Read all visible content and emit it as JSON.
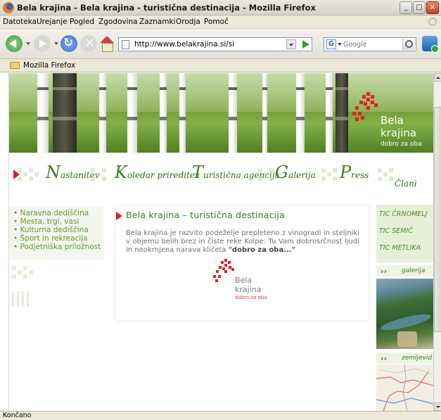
{
  "window": {
    "title": "Bela krajina - Bela krajina - turistična destinacija - Mozilla Firefox"
  },
  "menubar": {
    "items": [
      "Datoteka",
      "Urejanje",
      "Pogled",
      "Zgodovina",
      "Zaznamki",
      "Orodja",
      "Pomoč"
    ]
  },
  "navbar": {
    "url": "http://www.belakrajina.si/si",
    "search_placeholder": "Google"
  },
  "bookmarks": {
    "items": [
      "Mozilla Firefox"
    ]
  },
  "site": {
    "banner": {
      "brand_line1": "Bela",
      "brand_line2": "krajina",
      "slogan": "dobro za oba"
    },
    "nav": {
      "items": [
        {
          "cap": "N",
          "rest": "astanitev"
        },
        {
          "cap": "K",
          "rest": "oledar prireditev"
        },
        {
          "cap": "T",
          "rest": "uristična agencija"
        },
        {
          "cap": "G",
          "rest": "alerija"
        },
        {
          "cap": "P",
          "rest": "ress"
        },
        {
          "cap": "",
          "rest": "Člani"
        }
      ]
    },
    "left_menu": [
      "Naravna dediščina",
      "Mesta, trgi, vasi",
      "Kulturna dediščina",
      "Šport in rekreacija",
      "Podjetniška priložnost"
    ],
    "main": {
      "heading": "Bela krajina – turistična destinacija",
      "body": "Bela krajina je razvito podeželje prepleteno z vinogradi in steljniki v objemu belih brez in čiste reke Kolpe. Tu Vam dobrosrčnost ljudi in neokrnjena narava kličeta ",
      "body_bold": "\"dobro za oba...\"",
      "logo_line1": "Bela",
      "logo_line2": "krajina",
      "logo_slogan": "dobro za oba"
    },
    "right": {
      "tic": [
        "TIC ČRNOMELJ",
        "TIC SEMIČ",
        "TIC METLIKA"
      ],
      "gallery_label": "galerija",
      "map_label": "zemljevid"
    }
  },
  "statusbar": {
    "text": "Končano"
  },
  "colors": {
    "accent_green": "#3e7d24",
    "accent_red": "#e02020",
    "chrome": "#ece9d8"
  }
}
